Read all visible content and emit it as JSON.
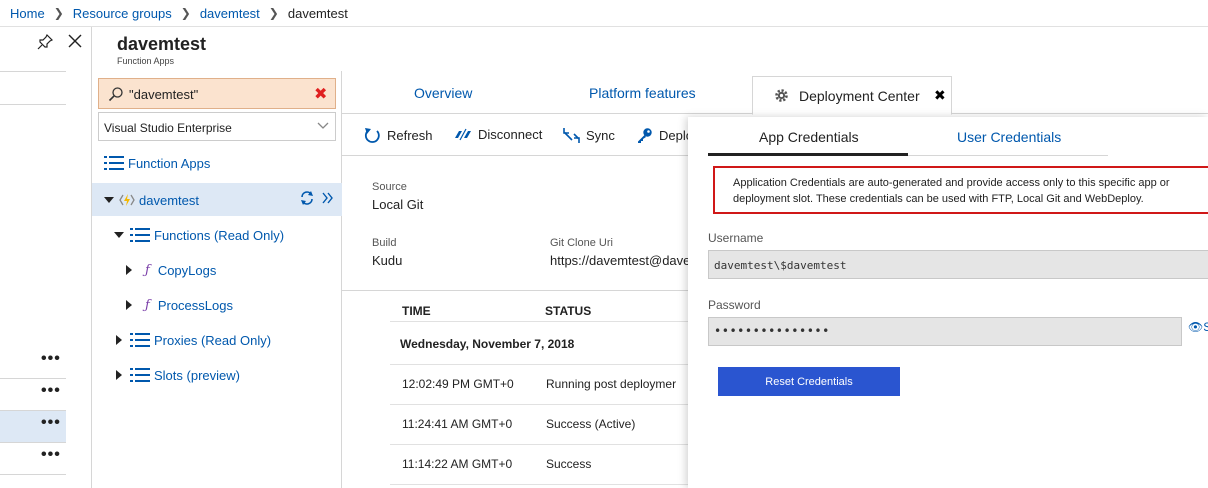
{
  "breadcrumb": [
    "Home",
    "Resource groups",
    "davemtest",
    "davemtest"
  ],
  "header": {
    "title": "davemtest",
    "subtitle": "Function Apps"
  },
  "tree": {
    "search_value": "\"davemtest\"",
    "subscription": "Visual Studio Enterprise",
    "function_apps_label": "Function Apps",
    "app_name": "davemtest",
    "functions_label": "Functions (Read Only)",
    "functions": [
      "CopyLogs",
      "ProcessLogs"
    ],
    "proxies_label": "Proxies (Read Only)",
    "slots_label": "Slots (preview)"
  },
  "left_blade": {
    "more": "•••"
  },
  "tabs": {
    "overview": "Overview",
    "platform": "Platform features",
    "deployment": "Deployment Center"
  },
  "toolbar": {
    "refresh": "Refresh",
    "disconnect": "Disconnect",
    "sync": "Sync",
    "deploy": "Deplo"
  },
  "details": {
    "source_label": "Source",
    "source_value": "Local Git",
    "build_label": "Build",
    "build_value": "Kudu",
    "git_label": "Git Clone Uri",
    "git_value": "https://davemtest@dave"
  },
  "history": {
    "col_time": "TIME",
    "col_status": "STATUS",
    "date": "Wednesday, November 7, 2018",
    "rows": [
      {
        "time": "12:02:49 PM GMT+0",
        "status": "Running post deploymer"
      },
      {
        "time": "11:24:41 AM GMT+0",
        "status": "Success (Active)"
      },
      {
        "time": "11:14:22 AM GMT+0",
        "status": "Success"
      }
    ]
  },
  "credentials": {
    "tab_app": "App Credentials",
    "tab_user": "User Credentials",
    "info_line1": "Application Credentials are auto-generated and provide access only to this specific app or",
    "info_line2": "deployment slot. These credentials can be used with FTP, Local Git and WebDeploy.",
    "username_label": "Username",
    "username_value": "davemtest\\$davemtest",
    "password_label": "Password",
    "password_value": "•••••••••••••••",
    "show_label": "S",
    "reset_label": "Reset Credentials"
  },
  "colors": {
    "link": "#0058ad",
    "accent": "#2a55d0",
    "highlight_border": "#d01818",
    "selected_row": "#dde8f5"
  }
}
